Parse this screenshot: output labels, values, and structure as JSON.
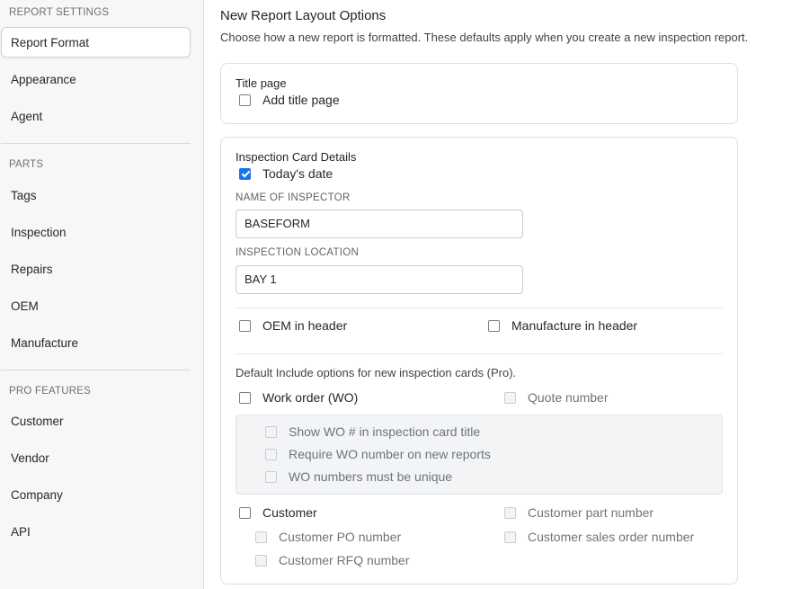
{
  "sidebar": {
    "report_settings_title": "REPORT SETTINGS",
    "report_settings_items": [
      {
        "label": "Report Format",
        "active": true
      },
      {
        "label": "Appearance"
      },
      {
        "label": "Agent"
      }
    ],
    "parts_title": "PARTS",
    "parts_items": [
      {
        "label": "Tags"
      },
      {
        "label": "Inspection"
      },
      {
        "label": "Repairs"
      },
      {
        "label": "OEM"
      },
      {
        "label": "Manufacture"
      }
    ],
    "pro_title": "PRO FEATURES",
    "pro_items": [
      {
        "label": "Customer"
      },
      {
        "label": "Vendor"
      },
      {
        "label": "Company"
      },
      {
        "label": "API"
      }
    ]
  },
  "main": {
    "title": "New Report Layout Options",
    "subtitle": "Choose how a new report is formatted. These defaults apply when you create a new inspection report.",
    "title_page_card": {
      "title": "Title page",
      "add_title_page": {
        "label": "Add title page",
        "checked": false
      }
    },
    "details_card": {
      "title": "Inspection Card Details",
      "todays_date": {
        "label": "Today's date",
        "checked": true
      },
      "inspector_label": "NAME OF INSPECTOR",
      "inspector_value": "BASEFORM",
      "location_label": "INSPECTION LOCATION",
      "location_value": "BAY 1",
      "oem_header": {
        "label": "OEM in header",
        "checked": false
      },
      "manufacture_header": {
        "label": "Manufacture in header",
        "checked": false
      },
      "pro_note": "Default Include options for new inspection cards (Pro).",
      "work_order": {
        "label": "Work order (WO)",
        "checked": false
      },
      "quote_number": {
        "label": "Quote number",
        "checked": false,
        "disabled": true
      },
      "wo_options": [
        {
          "label": "Show WO # in inspection card title",
          "checked": false,
          "disabled": true
        },
        {
          "label": "Require WO number on new reports",
          "checked": false,
          "disabled": true
        },
        {
          "label": "WO numbers must be unique",
          "checked": false,
          "disabled": true
        }
      ],
      "customer": {
        "label": "Customer",
        "checked": false
      },
      "customer_part_number": {
        "label": "Customer part number",
        "checked": false,
        "disabled": true
      },
      "customer_po_number": {
        "label": "Customer PO number",
        "checked": false,
        "disabled": true
      },
      "customer_sales_order_number": {
        "label": "Customer sales order number",
        "checked": false,
        "disabled": true
      },
      "customer_rfq_number": {
        "label": "Customer RFQ number",
        "checked": false,
        "disabled": true
      }
    }
  },
  "colors": {
    "accent": "#1a73e8",
    "sidebar_bg": "#f7f7f8",
    "border": "#dcdee2"
  }
}
